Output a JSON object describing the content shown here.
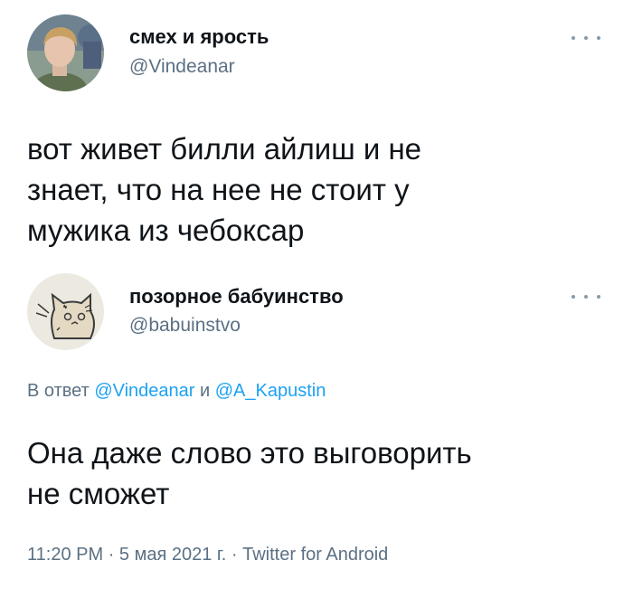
{
  "tweet": {
    "user": {
      "display_name": "смех и ярость",
      "handle": "@Vindeanar"
    },
    "text_lines": [
      "вот живет билли айлиш и не",
      "знает, что на нее не стоит у",
      "мужика из чебоксар"
    ]
  },
  "reply": {
    "user": {
      "display_name": "позорное бабуинство",
      "handle": "@babuinstvo"
    },
    "reply_to": {
      "prefix": "В ответ",
      "mention_1": "@Vindeanar",
      "conjunction": "и",
      "mention_2": "@A_Kapustin"
    },
    "text_lines": [
      "Она даже слово это выговорить",
      "не сможет"
    ],
    "meta": {
      "time": "11:20 PM",
      "separator": "·",
      "date": "5 мая 2021 г.",
      "source": "Twitter for Android"
    }
  },
  "colors": {
    "text": "#0f1419",
    "secondary": "#5b7083",
    "accent": "#1da1f2"
  },
  "icons": {
    "more": "more-horizontal-icon"
  }
}
